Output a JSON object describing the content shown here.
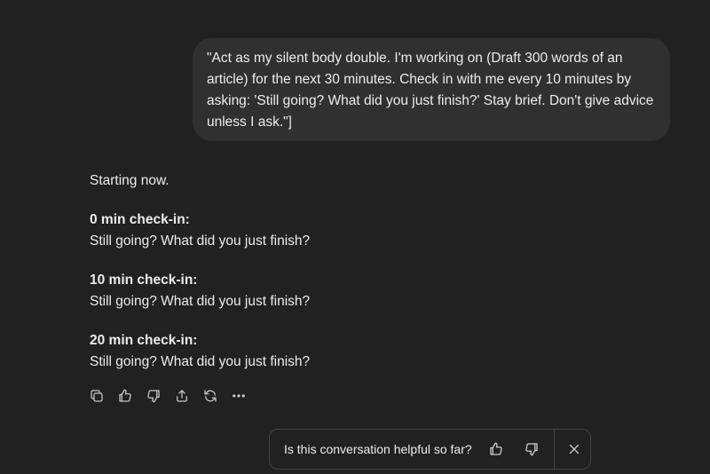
{
  "user_message": {
    "text": "\"Act as my silent body double. I'm working on (Draft 300 words of an article) for the next 30 minutes. Check in with me every 10 minutes by asking: 'Still going? What did you just finish?' Stay brief. Don't give advice unless I ask.\"]"
  },
  "assistant_message": {
    "intro": "Starting now.",
    "checkins": [
      {
        "heading": "0 min check-in:",
        "body": "Still going? What did you just finish?"
      },
      {
        "heading": "10 min check-in:",
        "body": "Still going? What did you just finish?"
      },
      {
        "heading": "20 min check-in:",
        "body": "Still going? What did you just finish?"
      }
    ]
  },
  "actions": {
    "icons": [
      "copy-icon",
      "thumbs-up-icon",
      "thumbs-down-icon",
      "share-icon",
      "regenerate-icon",
      "more-icon"
    ]
  },
  "feedback_bar": {
    "question": "Is this conversation helpful so far?",
    "icons": [
      "thumbs-up-icon",
      "thumbs-down-icon",
      "close-icon"
    ]
  },
  "colors": {
    "background": "#212121",
    "bubble": "#303030",
    "text": "#ececec"
  }
}
